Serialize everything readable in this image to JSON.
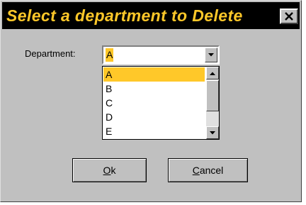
{
  "dialog": {
    "title": "Select a department to Delete",
    "close_glyph": "✕"
  },
  "form": {
    "department_label": "Department:",
    "department_value": "A"
  },
  "dropdown": {
    "options": [
      "A",
      "B",
      "C",
      "D",
      "E"
    ],
    "selected": "A"
  },
  "buttons": {
    "ok": {
      "mnemonic": "O",
      "rest": "k"
    },
    "cancel": {
      "mnemonic": "C",
      "rest": "ancel"
    }
  },
  "colors": {
    "title_bar": "#000000",
    "title_text": "#ffc829",
    "highlight": "#ffc829",
    "face": "#c0c0c0"
  },
  "icons": {
    "close": "close-icon",
    "dropdown": "chevron-down-icon",
    "scroll_up": "arrow-up-icon",
    "scroll_down": "arrow-down-icon"
  }
}
